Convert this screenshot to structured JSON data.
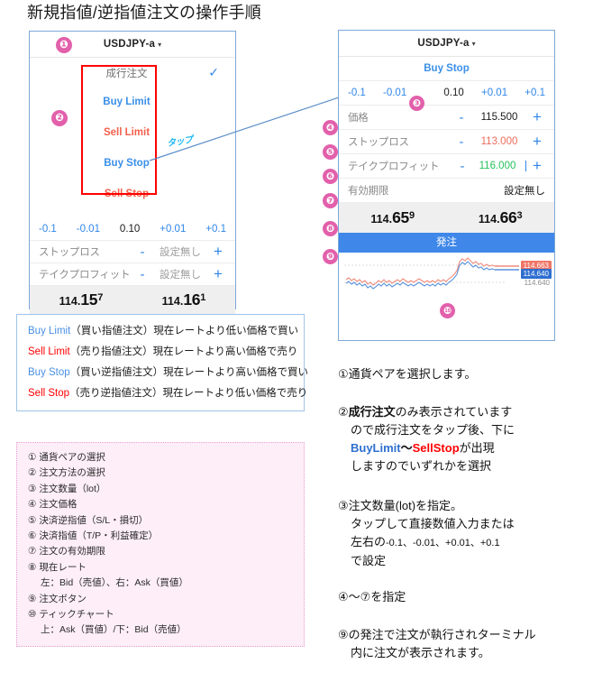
{
  "title": "新規指値/逆指値注文の操作手順",
  "left_panel": {
    "marker1": "❶",
    "marker2": "❷",
    "pair": "USDJPY-a",
    "caret": "▾",
    "order_types": {
      "market": "成行注文",
      "check": "✓",
      "buy_limit": "Buy Limit",
      "sell_limit": "Sell Limit",
      "buy_stop": "Buy Stop",
      "sell_stop": "Sell Stop"
    },
    "lot": {
      "minus_big": "-0.1",
      "minus_small": "-0.01",
      "value": "0.10",
      "plus_small": "+0.01",
      "plus_big": "+0.1"
    },
    "stoploss": {
      "label": "ストップロス",
      "minus": "-",
      "value": "設定無し",
      "plus": "+"
    },
    "takeprofit": {
      "label": "テイクプロフィット",
      "minus": "-",
      "value": "設定無し",
      "plus": "+"
    },
    "bid": {
      "int": "114.",
      "big": "15",
      "sup": "7"
    },
    "ask": {
      "int": "114.",
      "big": "16",
      "sup": "1"
    },
    "tap_note": "タップ"
  },
  "right_panel": {
    "pair": "USDJPY-a",
    "caret": "▾",
    "order_type": "Buy Stop",
    "marker3": "❸",
    "marker4": "❹",
    "marker5": "❺",
    "marker6": "❻",
    "marker7": "❼",
    "marker8": "❽",
    "marker9": "❾",
    "marker10": "❿",
    "lot": {
      "minus_big": "-0.1",
      "minus_small": "-0.01",
      "value": "0.10",
      "plus_small": "+0.01",
      "plus_big": "+0.1"
    },
    "price": {
      "label": "価格",
      "minus": "-",
      "value": "115.500",
      "plus": "+"
    },
    "stoploss": {
      "label": "ストップロス",
      "minus": "-",
      "value": "113.000",
      "plus": "+"
    },
    "takeprofit": {
      "label": "テイクプロフィット",
      "minus": "-",
      "value": "116.000",
      "plus": "+"
    },
    "expiry": {
      "label": "有効期限",
      "value": "設定無し"
    },
    "bid": {
      "int": "114.",
      "big": "65",
      "sup": "9"
    },
    "ask": {
      "int": "114.",
      "big": "66",
      "sup": "3"
    },
    "submit": "発注",
    "chart": {
      "ask_tag": "114.663",
      "bid_tag": "114.640",
      "low_label": "114.640"
    }
  },
  "legend_box": [
    {
      "key": "Buy Limit",
      "key_color": "blue",
      "text": "（買い指値注文）現在レートより低い価格で買い"
    },
    {
      "key": "Sell Limit",
      "key_color": "red",
      "text": "（売り指値注文）現在レートより高い価格で売り"
    },
    {
      "key": "Buy Stop",
      "key_color": "blue",
      "text": "（買い逆指値注文）現在レートより高い価格で買い"
    },
    {
      "key": "Sell Stop",
      "key_color": "red",
      "text": "（売り逆指値注文）現在レートより低い価格で売り"
    }
  ],
  "numbered_list": [
    {
      "t": "① 通貨ペアの選択",
      "indent": false
    },
    {
      "t": "② 注文方法の選択",
      "indent": false
    },
    {
      "t": "③ 注文数量（lot）",
      "indent": false
    },
    {
      "t": "④ 注文価格",
      "indent": false
    },
    {
      "t": "⑤ 決済逆指値（S/L・損切）",
      "indent": false
    },
    {
      "t": "⑥ 決済指値（T/P・利益確定）",
      "indent": false
    },
    {
      "t": "⑦ 注文の有効期限",
      "indent": false
    },
    {
      "t": "⑧ 現在レート",
      "indent": false
    },
    {
      "t": "左：Bid（売値）、右：Ask（買値）",
      "indent": true
    },
    {
      "t": "⑨ 注文ボタン",
      "indent": false
    },
    {
      "t": "⑩ ティックチャート",
      "indent": false
    },
    {
      "t": "上：Ask（買値）/下：Bid（売値）",
      "indent": true
    }
  ],
  "explanations": {
    "e1": "①通貨ペアを選択します。",
    "e2_l1_a": "②",
    "e2_l1_b": "成行注文",
    "e2_l1_c": "のみ表示されています",
    "e2_l2": "ので成行注文をタップ後、下に",
    "e2_l3_a": "BuyLimit",
    "e2_l3_b": "〜",
    "e2_l3_c": "SellStop",
    "e2_l3_d": "が出現",
    "e2_l4": "しますのでいずれかを選択",
    "e3_l1": "③注文数量(lot)を指定。",
    "e3_l2": "タップして直接数値入力または",
    "e3_l3_a": "左右の",
    "e3_l3_b": "-0.1、-0.01、+0.01、+0.1",
    "e3_l4": "で設定",
    "e4": "④〜⑦を指定",
    "e5_l1": "⑨の発注で注文が執行されターミナル",
    "e5_l2": "内に注文が表示されます。"
  },
  "colors": {
    "accent_pink": "#e260ab",
    "blue": "#2f86e8",
    "red": "#ff0000",
    "submit_blue": "#3f87e8",
    "tp_green": "#25c25b",
    "sl_red": "#ef6b5a"
  }
}
